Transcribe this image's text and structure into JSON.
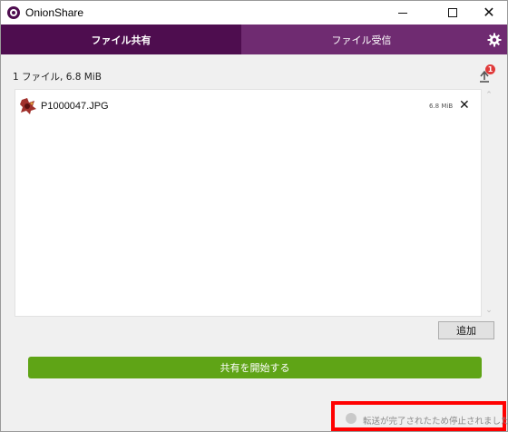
{
  "window": {
    "title": "OnionShare"
  },
  "tabs": [
    {
      "label": "ファイル共有",
      "active": true
    },
    {
      "label": "ファイル受信",
      "active": false
    }
  ],
  "summary": "1 ファイル, 6.8 MiB",
  "history_badge": "1",
  "files": [
    {
      "name": "P1000047.JPG",
      "size": "6.8 MiB"
    }
  ],
  "buttons": {
    "add": "追加",
    "start_sharing": "共有を開始する"
  },
  "status": {
    "message": "転送が完了されたため停止されました"
  },
  "colors": {
    "tab_active": "#4e0d4f",
    "tab_inactive": "#6f2b71",
    "start_button": "#5fa416",
    "highlight": "#ff0000",
    "badge": "#e03a3a"
  },
  "icons": {
    "app": "onionshare-logo-icon",
    "settings": "gear-icon",
    "history": "upload-history-icon",
    "file": "image-file-icon",
    "remove": "close-icon"
  }
}
